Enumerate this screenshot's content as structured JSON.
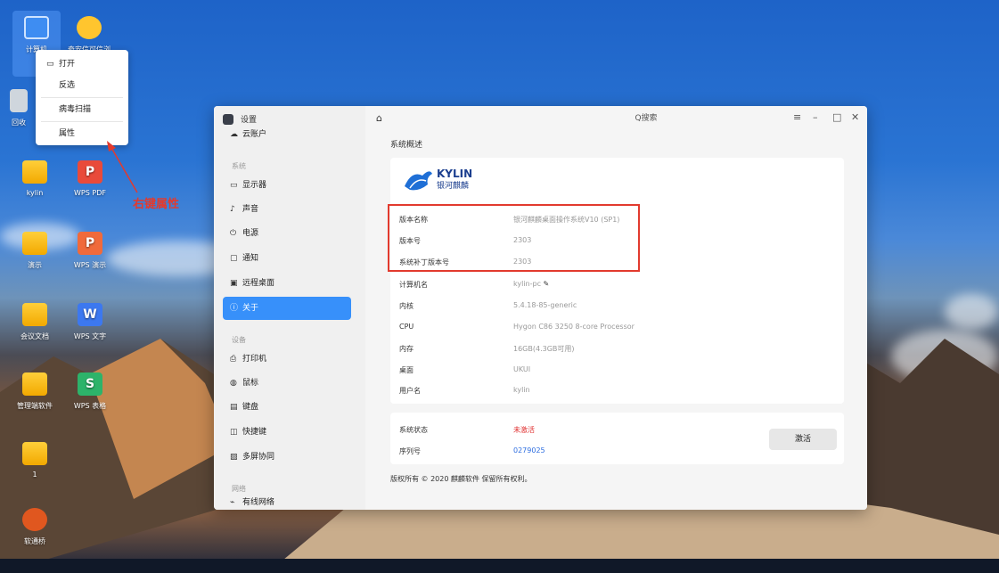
{
  "desktop": {
    "icons": [
      {
        "label": "计算机"
      },
      {
        "label": "奇安信可信浏"
      },
      {
        "label": "回收"
      },
      {
        "label": "kylin"
      },
      {
        "label": "WPS PDF"
      },
      {
        "label": "演示"
      },
      {
        "label": "WPS 演示"
      },
      {
        "label": "会议文档"
      },
      {
        "label": "WPS 文字"
      },
      {
        "label": "管理端软件"
      },
      {
        "label": "WPS 表格"
      },
      {
        "label": "1"
      },
      {
        "label": "软通桥"
      }
    ]
  },
  "context_menu": {
    "items": [
      {
        "label": "打开",
        "icon": "folder-open-icon"
      },
      {
        "label": "反选"
      },
      {
        "label": "病毒扫描"
      },
      {
        "label": "属性"
      }
    ]
  },
  "annotation": {
    "text": "右键属性",
    "color": "#e23a2e"
  },
  "settings": {
    "app_title": "设置",
    "search_label": "Q搜索",
    "window_controls": {
      "menu": "≡",
      "minimize": "–",
      "maximize": "□",
      "close": "✕"
    },
    "sidebar": {
      "top_item": "云账户",
      "group_system": "系统",
      "system_items": [
        "显示器",
        "声音",
        "电源",
        "通知",
        "远程桌面",
        "关于"
      ],
      "group_devices": "设备",
      "device_items": [
        "打印机",
        "鼠标",
        "键盘",
        "快捷键",
        "多屏协同"
      ],
      "group_network": "网络",
      "network_items": [
        "有线网络"
      ]
    },
    "page_title": "系统概述",
    "logo": {
      "brand": "KYLIN",
      "sub": "银河麒麟"
    },
    "info": [
      {
        "key": "版本名称",
        "value": "银河麒麟桌面操作系统V10 (SP1)"
      },
      {
        "key": "版本号",
        "value": "2303"
      },
      {
        "key": "系统补丁版本号",
        "value": "2303"
      },
      {
        "key": "计算机名",
        "value": "kylin-pc"
      },
      {
        "key": "内核",
        "value": "5.4.18-85-generic"
      },
      {
        "key": "CPU",
        "value": "Hygon C86 3250  8-core Processor"
      },
      {
        "key": "内存",
        "value": "16GB(4.3GB可用)"
      },
      {
        "key": "桌面",
        "value": "UKUI"
      },
      {
        "key": "用户名",
        "value": "kylin"
      }
    ],
    "status": {
      "status_label": "系统状态",
      "status_value": "未激活",
      "serial_label": "序列号",
      "serial_value": "0279025",
      "activate_button": "激活"
    },
    "copyright": "版权所有 © 2020 麒麟软件 保留所有权利。",
    "accent_color": "#3790fa"
  }
}
